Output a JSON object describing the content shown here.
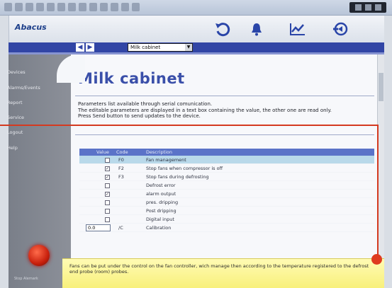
{
  "app": {
    "logo": "Abacus",
    "header_icons": [
      "undo-icon",
      "alarm-bell-icon",
      "chart-icon",
      "back-arrow-icon"
    ]
  },
  "nav": {
    "selected_device": "Milk cabinet"
  },
  "sidebar": {
    "items": [
      {
        "label": "Devices"
      },
      {
        "label": "Alarms/Events"
      },
      {
        "label": "Report"
      },
      {
        "label": "Service"
      },
      {
        "label": "Logout"
      },
      {
        "label": "Help"
      }
    ],
    "power_label": "Stop Alemark"
  },
  "page": {
    "title": "Milk cabinet",
    "desc1": "Parameters list available through serial comunication.",
    "desc2": "The editable parameters are displayed in a text box containing the value, the other one are read only.",
    "desc3": "Press Send button to send updates to the device."
  },
  "table": {
    "headers": [
      "Value",
      "Code",
      "Description"
    ],
    "rows": [
      {
        "checked": false,
        "code": "F0",
        "description": "Fan management",
        "highlight": true
      },
      {
        "checked": true,
        "code": "F2",
        "description": "Stop fans when compressor is off",
        "highlight": false
      },
      {
        "checked": true,
        "code": "F3",
        "description": "Stop fans during defrosting",
        "highlight": false
      },
      {
        "checked": false,
        "code": "",
        "description": "Defrost error",
        "highlight": false
      },
      {
        "checked": true,
        "code": "",
        "description": "alarm output",
        "highlight": false
      },
      {
        "checked": false,
        "code": "",
        "description": "pres. dripping",
        "highlight": false
      },
      {
        "checked": false,
        "code": "",
        "description": "Post dripping",
        "highlight": false
      },
      {
        "checked": false,
        "code": "",
        "description": "Digital input",
        "highlight": false
      },
      {
        "value": "0.0",
        "code": "/C",
        "description": "Calibration",
        "highlight": false
      }
    ]
  },
  "footer": {
    "text": "Fans can be put under the control on the fan controller, wich manage then according to the temperature registered to the defrost end probe (room) probes."
  },
  "colors": {
    "accent_blue": "#3145a5",
    "title_blue": "#3a4fa9",
    "callout_red": "#d43a20",
    "footer_yellow": "#f8f07b"
  }
}
